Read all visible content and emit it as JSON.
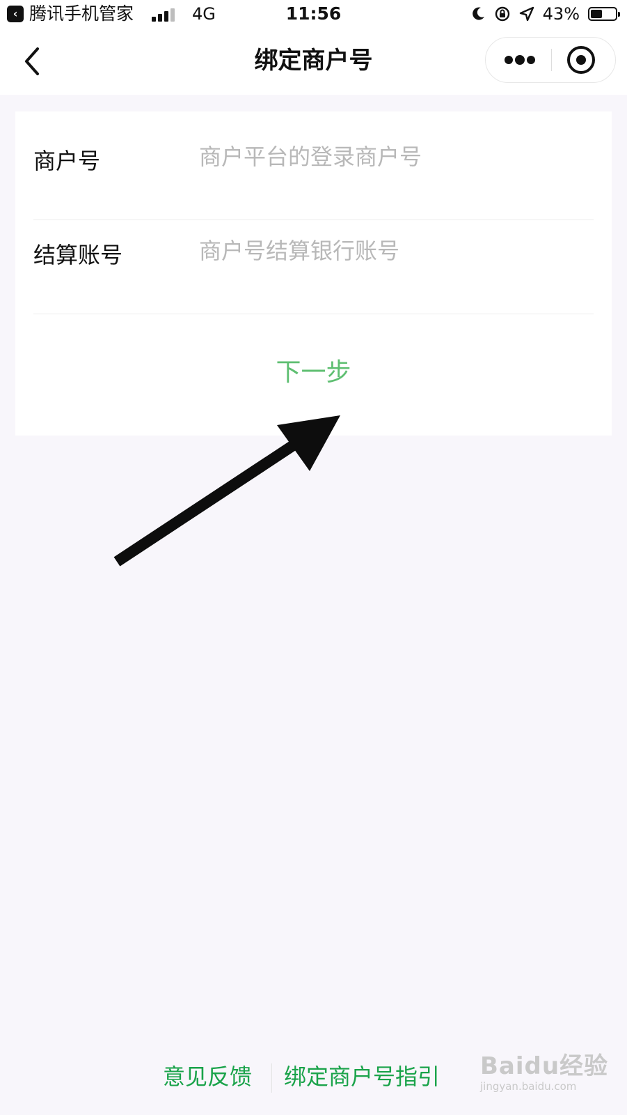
{
  "status_bar": {
    "back_app": "腾讯手机管家",
    "network": "4G",
    "time": "11:56",
    "battery": "43%"
  },
  "nav": {
    "title": "绑定商户号"
  },
  "form": {
    "merchant_label": "商户号",
    "merchant_placeholder": "商户平台的登录商户号",
    "account_label": "结算账号",
    "account_placeholder": "商户号结算银行账号",
    "next_button": "下一步"
  },
  "footer": {
    "feedback": "意见反馈",
    "guide": "绑定商户号指引"
  },
  "watermark": {
    "brand": "Baidu经验",
    "url": "jingyan.baidu.com"
  },
  "colors": {
    "accent_green": "#1aa34a",
    "next_green": "#5fbf72",
    "background": "#f8f6fb"
  }
}
